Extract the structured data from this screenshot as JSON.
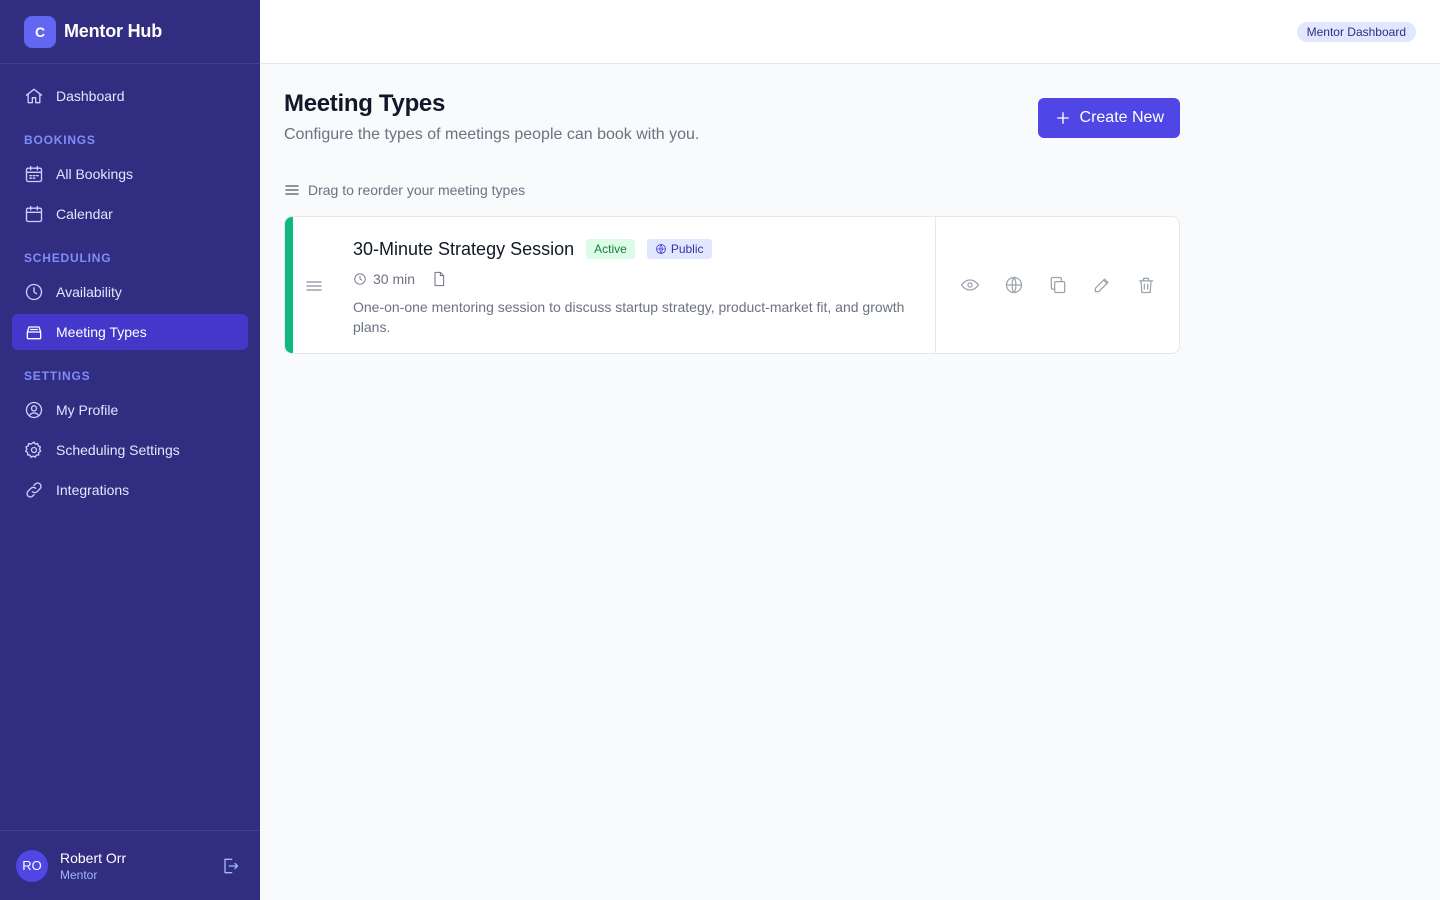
{
  "app": {
    "logo_letter": "C",
    "name": "Mentor Hub"
  },
  "sidebar": {
    "top_item": {
      "label": "Dashboard",
      "icon": "home-icon"
    },
    "sections": [
      {
        "title": "BOOKINGS",
        "items": [
          {
            "label": "All Bookings",
            "icon": "calendar-list-icon"
          },
          {
            "label": "Calendar",
            "icon": "calendar-icon"
          }
        ]
      },
      {
        "title": "SCHEDULING",
        "items": [
          {
            "label": "Availability",
            "icon": "clock-icon"
          },
          {
            "label": "Meeting Types",
            "icon": "inbox-icon",
            "active": true
          }
        ]
      },
      {
        "title": "SETTINGS",
        "items": [
          {
            "label": "My Profile",
            "icon": "user-circle-icon"
          },
          {
            "label": "Scheduling Settings",
            "icon": "gear-icon"
          },
          {
            "label": "Integrations",
            "icon": "link-icon"
          }
        ]
      }
    ]
  },
  "user": {
    "initials": "RO",
    "name": "Robert Orr",
    "role": "Mentor"
  },
  "topbar": {
    "badge": "Mentor Dashboard"
  },
  "page": {
    "title": "Meeting Types",
    "subtitle": "Configure the types of meetings people can book with you.",
    "create_label": "Create New",
    "hint": "Drag to reorder your meeting types"
  },
  "meeting_types": [
    {
      "title": "30-Minute Strategy Session",
      "status": "Active",
      "visibility": "Public",
      "duration": "30 min",
      "description": "One-on-one mentoring session to discuss startup strategy, product-market fit, and growth plans.",
      "accent_color": "#10b981"
    }
  ],
  "colors": {
    "sidebar_bg": "#312e81",
    "accent": "#4f46e5",
    "active_status": "#15803d"
  }
}
